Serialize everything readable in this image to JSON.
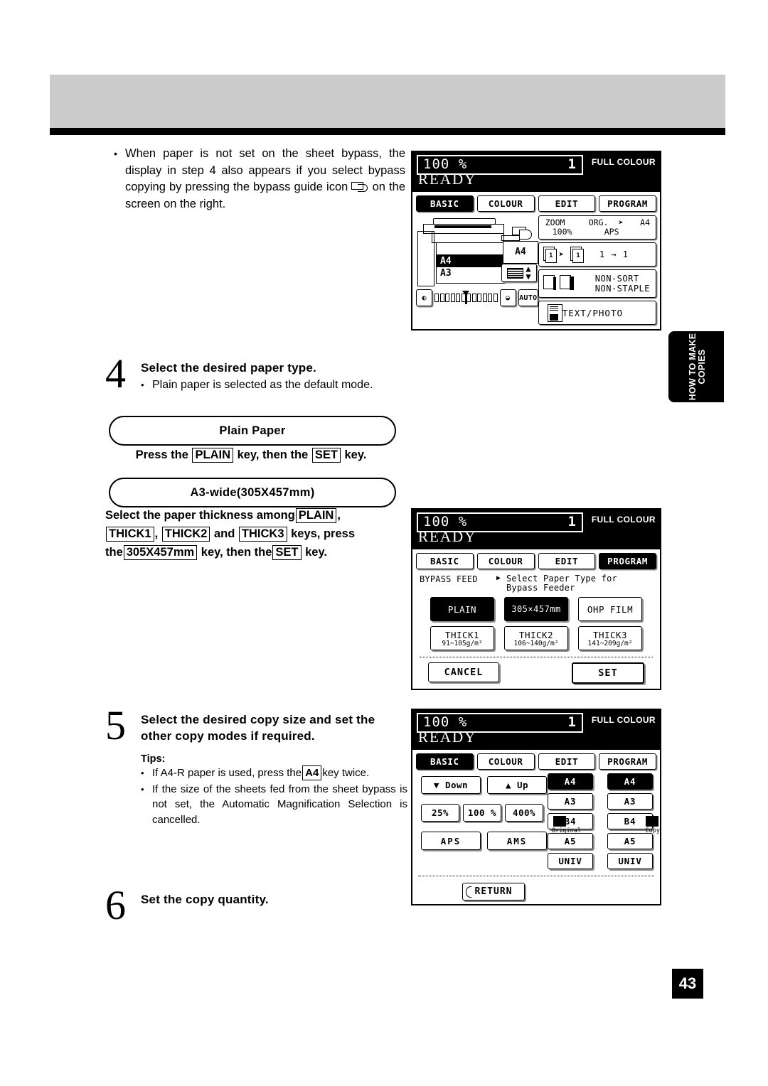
{
  "page": {
    "number": "43",
    "side_tab": "HOW TO MAKE COPIES"
  },
  "intro_note": {
    "bullet": "•",
    "text_a": "When paper is not set on the sheet bypass, the display in step 4 also appears if you select bypass copying by pressing the bypass guide icon",
    "icon_name": "bypass-guide-icon",
    "text_b": "on the screen on the right."
  },
  "step4": {
    "number": "4",
    "title": "Select the desired paper type.",
    "bullet": "•",
    "note": "Plain paper is selected as the default mode.",
    "capsule_plain": "Plain Paper",
    "plain_instruction": {
      "pre": "Press the",
      "key1": "PLAIN",
      "mid": "key, then the",
      "key2": "SET",
      "post": "key."
    },
    "capsule_a3wide": "A3-wide(305X457mm)",
    "a3_instruction": {
      "l1_pre": "Select the paper thickness among",
      "l1_key": "PLAIN",
      "l1_post": ",",
      "l2_key1": "THICK1",
      "l2_sep1": ",",
      "l2_key2": "THICK2",
      "l2_mid": "and",
      "l2_key3": "THICK3",
      "l2_post": "keys, press",
      "l3_pre": "the",
      "l3_key1": "305X457mm",
      "l3_mid": "key, then the",
      "l3_key2": "SET",
      "l3_post": "key."
    }
  },
  "step5": {
    "number": "5",
    "title_l1": "Select the desired copy size and set the",
    "title_l2": "other copy modes if required.",
    "tips_header": "Tips:",
    "bullet": "•",
    "tip1_pre": "If A4-R paper is used, press the",
    "tip1_key": "A4",
    "tip1_post": "key twice.",
    "tip2": "If the size of the sheets fed from the sheet bypass is not set, the Automatic Magnification Selection is cancelled."
  },
  "step6": {
    "number": "6",
    "title": "Set the copy quantity."
  },
  "lcd_common": {
    "ratio": "100 %",
    "percent_sym": "%",
    "ratio_num": "100",
    "quantity": "1",
    "colour_mode": "FULL COLOUR",
    "status": "READY",
    "tabs": [
      "BASIC",
      "COLOUR",
      "EDIT",
      "PROGRAM"
    ]
  },
  "lcd_panel1": {
    "selected_tab": "BASIC",
    "cassette_sizes": [
      "",
      "A4",
      "A3"
    ],
    "selected_cassette": "A4",
    "output_size": "A4",
    "density_auto": "AUTO",
    "zoom_label": "ZOOM",
    "zoom_value": "100%",
    "org_label": "ORG.",
    "org_arrow": "➜",
    "org_size": "A4",
    "aps_label": "APS",
    "duplex_label": "1 → 1",
    "finish_l1": "NON-SORT",
    "finish_l2": "NON-STAPLE",
    "mode_label": "TEXT/PHOTO"
  },
  "lcd_panel2": {
    "selected_tab": "PROGRAM",
    "feed_title": "BYPASS FEED",
    "triangle": "▶",
    "desc_l1": "Select Paper Type for",
    "desc_l2": "Bypass Feeder",
    "buttons_row1": [
      {
        "label": "PLAIN",
        "weight": "",
        "selected": true
      },
      {
        "label": "305×457mm",
        "weight": "",
        "selected": true
      },
      {
        "label": "OHP FILM",
        "weight": "",
        "selected": false
      }
    ],
    "buttons_row2": [
      {
        "label": "THICK1",
        "weight": "91~105g/m²",
        "selected": false
      },
      {
        "label": "THICK2",
        "weight": "106~140g/m²",
        "selected": false
      },
      {
        "label": "THICK3",
        "weight": "141~209g/m²",
        "selected": false
      }
    ],
    "cancel_label": "CANCEL",
    "set_label": "SET"
  },
  "lcd_panel3": {
    "selected_tab": "BASIC",
    "down_label": "▼ Down",
    "up_label": "▲ Up",
    "zoom_presets": [
      "25%",
      "100 %",
      "400%"
    ],
    "aps_label": "APS",
    "ams_label": "AMS",
    "original_label": "Original",
    "copy_label": "Copy",
    "original_sizes": [
      {
        "label": "A4",
        "selected": true
      },
      {
        "label": "A3",
        "selected": false
      },
      {
        "label": "B4",
        "selected": false
      },
      {
        "label": "A5",
        "selected": false
      },
      {
        "label": "UNIV",
        "selected": false
      }
    ],
    "copy_sizes": [
      {
        "label": "A4",
        "selected": true
      },
      {
        "label": "A3",
        "selected": false
      },
      {
        "label": "B4",
        "selected": false
      },
      {
        "label": "A5",
        "selected": false
      },
      {
        "label": "UNIV",
        "selected": false
      }
    ],
    "return_label": "RETURN"
  },
  "colors": {
    "header_gray": "#cbcbcb",
    "ink_black": "#000000",
    "shadow_gray": "#8a8a8a"
  }
}
